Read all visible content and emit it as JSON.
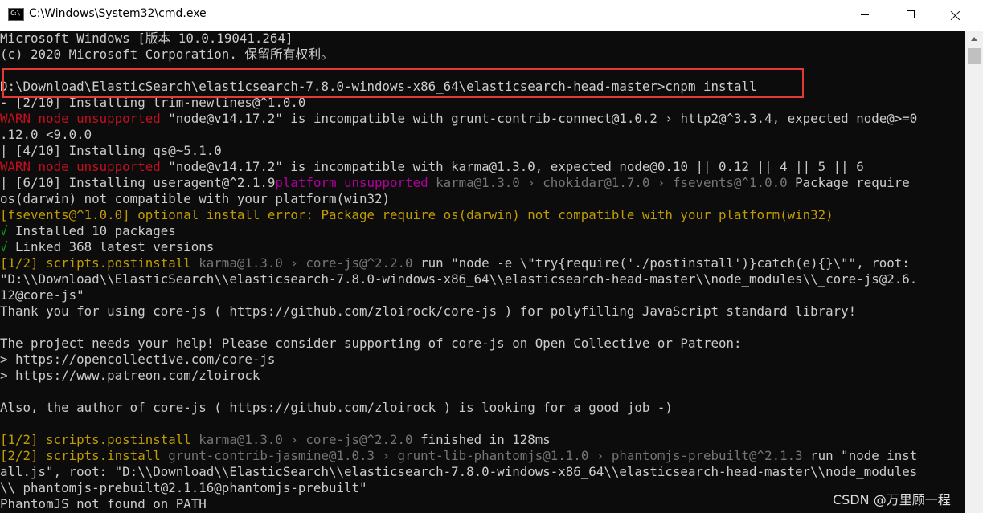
{
  "window": {
    "title": "C:\\Windows\\System32\\cmd.exe",
    "icon": "cmd-icon",
    "icon_text": "C:\\"
  },
  "colors": {
    "default": "#cccccc",
    "warn": "#c50f1f",
    "magenta": "#b4009e",
    "gray": "#767676",
    "yellow": "#c19c00",
    "green": "#13a10e",
    "highlight": "#e53935"
  },
  "console": {
    "lines": [
      [
        {
          "t": "Microsoft Windows [版本 10.0.19041.264]",
          "c": "default"
        }
      ],
      [
        {
          "t": "(c) 2020 Microsoft Corporation. 保留所有权利。",
          "c": "default"
        }
      ],
      [
        {
          "t": "",
          "c": "default"
        }
      ],
      [
        {
          "t": "D:\\Download\\ElasticSearch\\elasticsearch-7.8.0-windows-x86_64\\elasticsearch-head-master>cnpm install",
          "c": "default"
        }
      ],
      [
        {
          "t": "- [2/10] Installing trim-newlines@^1.0.0",
          "c": "default"
        }
      ],
      [
        {
          "t": "WARN node unsupported",
          "c": "warn"
        },
        {
          "t": " \"node@v14.17.2\" is incompatible with grunt-contrib-connect@1.0.2 › http2@^3.3.4, expected node@>=0",
          "c": "default"
        }
      ],
      [
        {
          "t": ".12.0 <9.0.0",
          "c": "default"
        }
      ],
      [
        {
          "t": "| [4/10] Installing qs@~5.1.0",
          "c": "default"
        }
      ],
      [
        {
          "t": "WARN node unsupported",
          "c": "warn"
        },
        {
          "t": " \"node@v14.17.2\" is incompatible with karma@1.3.0, expected node@0.10 || 0.12 || 4 || 5 || 6",
          "c": "default"
        }
      ],
      [
        {
          "t": "| [6/10] Installing useragent@^2.1.9",
          "c": "default"
        },
        {
          "t": "platform unsupported",
          "c": "magenta"
        },
        {
          "t": " karma@1.3.0 › chokidar@1.7.0 › fsevents@^1.0.0",
          "c": "gray"
        },
        {
          "t": " Package require",
          "c": "default"
        }
      ],
      [
        {
          "t": "os(darwin) not compatible with your platform(win32)",
          "c": "default"
        }
      ],
      [
        {
          "t": "[fsevents@^1.0.0] optional install error: Package require os(darwin) not compatible with your platform(win32)",
          "c": "yellow"
        }
      ],
      [
        {
          "t": "√",
          "c": "green"
        },
        {
          "t": " Installed 10 packages",
          "c": "default"
        }
      ],
      [
        {
          "t": "√",
          "c": "green"
        },
        {
          "t": " Linked 368 latest versions",
          "c": "default"
        }
      ],
      [
        {
          "t": "[1/2] scripts.postinstall",
          "c": "yellow"
        },
        {
          "t": " karma@1.3.0 › core-js@^2.2.0",
          "c": "gray"
        },
        {
          "t": " run \"node -e \\\"try{require('./postinstall')}catch(e){}\\\"\", root:",
          "c": "default"
        }
      ],
      [
        {
          "t": "\"D:\\\\Download\\\\ElasticSearch\\\\elasticsearch-7.8.0-windows-x86_64\\\\elasticsearch-head-master\\\\node_modules\\\\_core-js@2.6.",
          "c": "default"
        }
      ],
      [
        {
          "t": "12@core-js\"",
          "c": "default"
        }
      ],
      [
        {
          "t": "Thank you for using core-js ( https://github.com/zloirock/core-js ) for polyfilling JavaScript standard library!",
          "c": "default"
        }
      ],
      [
        {
          "t": "",
          "c": "default"
        }
      ],
      [
        {
          "t": "The project needs your help! Please consider supporting of core-js on Open Collective or Patreon:",
          "c": "default"
        }
      ],
      [
        {
          "t": "> https://opencollective.com/core-js",
          "c": "default"
        }
      ],
      [
        {
          "t": "> https://www.patreon.com/zloirock",
          "c": "default"
        }
      ],
      [
        {
          "t": "",
          "c": "default"
        }
      ],
      [
        {
          "t": "Also, the author of core-js ( https://github.com/zloirock ) is looking for a good job -)",
          "c": "default"
        }
      ],
      [
        {
          "t": "",
          "c": "default"
        }
      ],
      [
        {
          "t": "[1/2] scripts.postinstall",
          "c": "yellow"
        },
        {
          "t": " karma@1.3.0 › core-js@^2.2.0",
          "c": "gray"
        },
        {
          "t": " finished in 128ms",
          "c": "default"
        }
      ],
      [
        {
          "t": "[2/2] scripts.install",
          "c": "yellow"
        },
        {
          "t": " grunt-contrib-jasmine@1.0.3 › grunt-lib-phantomjs@1.1.0 › phantomjs-prebuilt@^2.1.3",
          "c": "gray"
        },
        {
          "t": " run \"node inst",
          "c": "default"
        }
      ],
      [
        {
          "t": "all.js\", root: \"D:\\\\Download\\\\ElasticSearch\\\\elasticsearch-7.8.0-windows-x86_64\\\\elasticsearch-head-master\\\\node_modules",
          "c": "default"
        }
      ],
      [
        {
          "t": "\\\\_phantomjs-prebuilt@2.1.16@phantomjs-prebuilt\"",
          "c": "default"
        }
      ],
      [
        {
          "t": "PhantomJS not found on PATH",
          "c": "default"
        }
      ]
    ]
  },
  "watermark": "CSDN @万里顾一程"
}
